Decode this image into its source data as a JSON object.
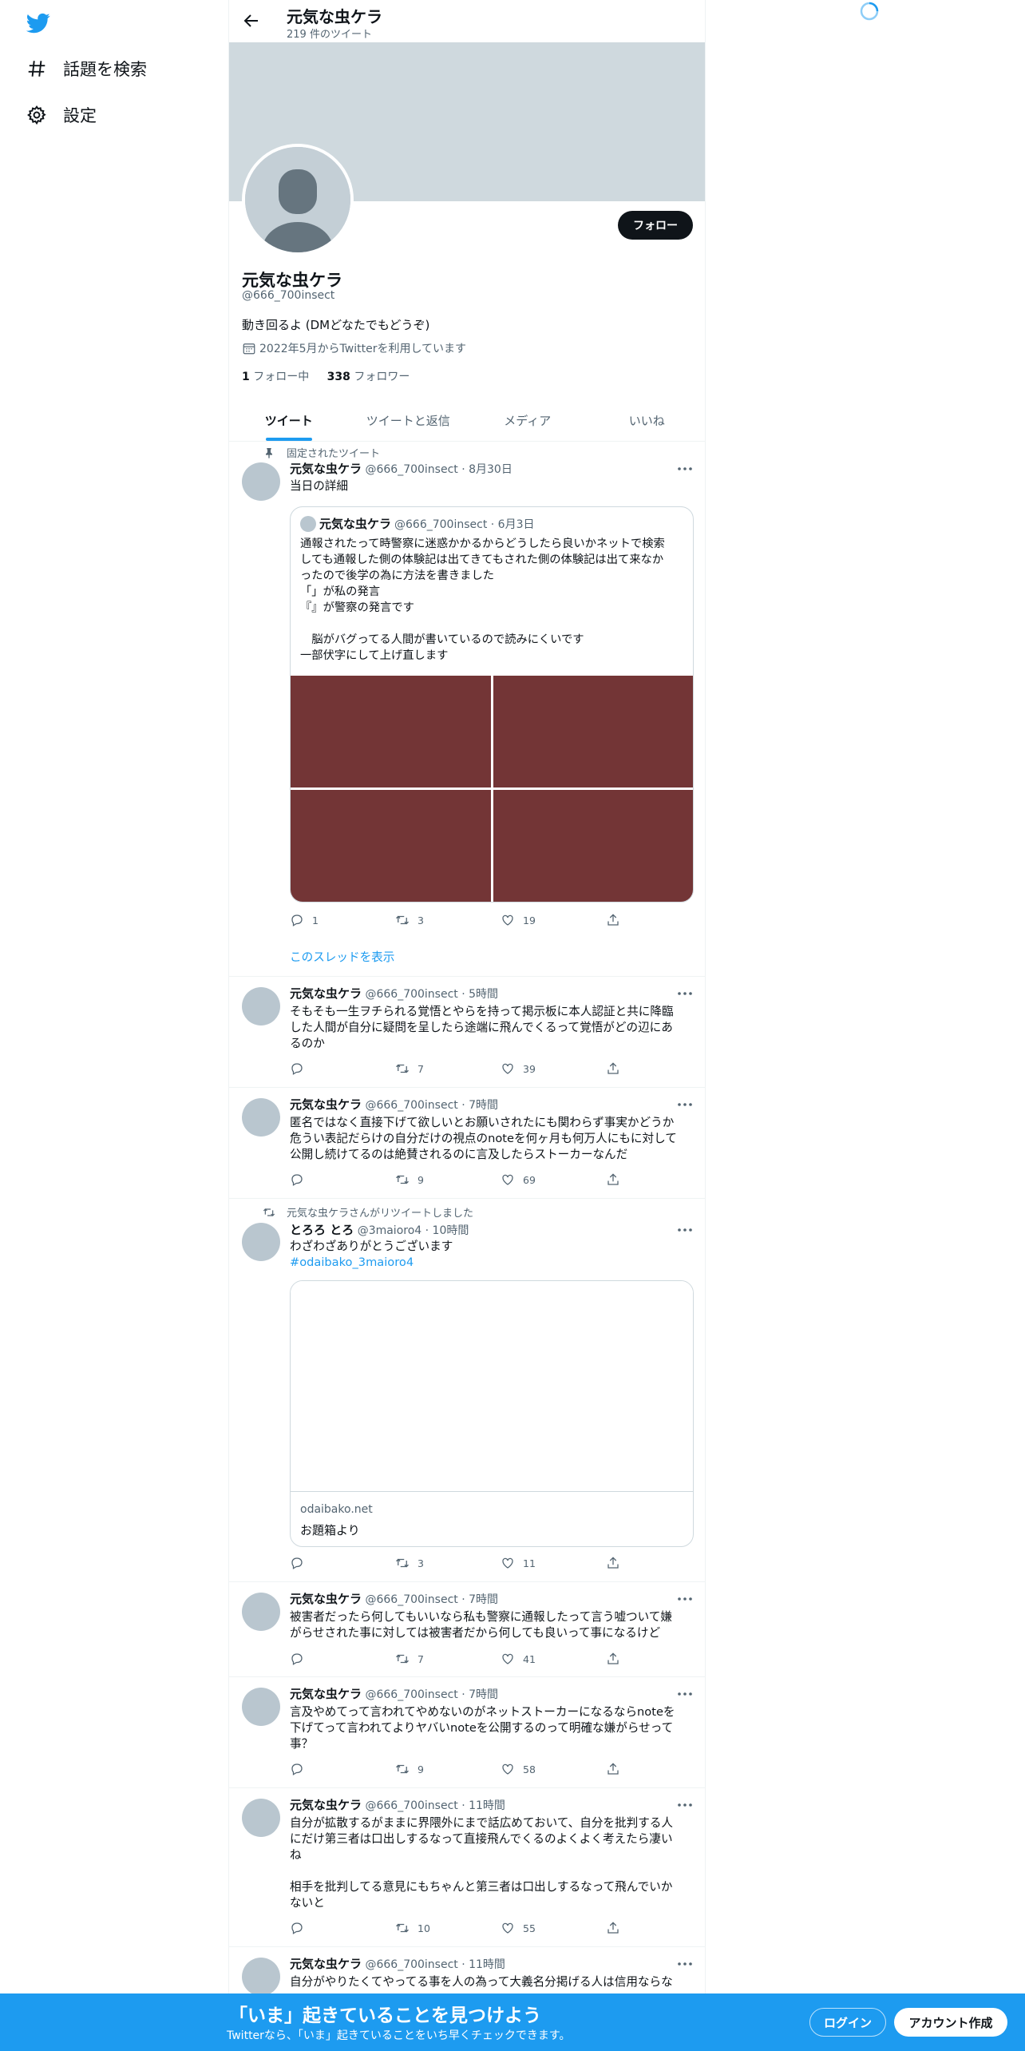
{
  "nav": {
    "explore_label": "話題を検索",
    "settings_label": "設定"
  },
  "header": {
    "title": "元気な虫ケラ",
    "subtitle": "219 件のツイート"
  },
  "profile": {
    "follow_button": "フォロー",
    "name": "元気な虫ケラ",
    "handle": "@666_700insect",
    "bio": "動き回るよ (DMどなたでもどうぞ)",
    "joined": "2022年5月からTwitterを利用しています",
    "following_count": "1",
    "following_label": "フォロー中",
    "followers_count": "338",
    "followers_label": "フォロワー"
  },
  "tabs": [
    "ツイート",
    "ツイートと返信",
    "メディア",
    "いいね"
  ],
  "tweets": [
    {
      "social": "固定されたツイート",
      "name": "元気な虫ケラ",
      "meta": "@666_700insect · 8月30日",
      "text": "当日の詳細",
      "quote": {
        "name": "元気な虫ケラ",
        "meta": "@666_700insect · 6月3日",
        "text": "通報されたって時警察に迷惑かかるからどうしたら良いかネットで検索\nしても通報した側の体験記は出てきてもされた側の体験記は出て来なか\nったので後学の為に方法を書きました\n「」が私の発言\n『』が警察の発言です\n\n　脳がバグってる人間が書いているので読みにくいです\n一部伏字にして上げ直します"
      },
      "reply": "1",
      "retweet": "3",
      "like": "19",
      "thread_link": "このスレッドを表示"
    },
    {
      "name": "元気な虫ケラ",
      "meta": "@666_700insect · 5時間",
      "text": "そもそも一生ヲチられる覚悟とやらを持って掲示板に本人認証と共に降臨\nした人間が自分に疑問を呈したら途端に飛んでくるって覚悟がどの辺にあ\nるのか",
      "reply": "",
      "retweet": "7",
      "like": "39"
    },
    {
      "name": "元気な虫ケラ",
      "meta": "@666_700insect · 7時間",
      "text": "匿名ではなく直接下げて欲しいとお願いされたにも関わらず事実かどうか\n危うい表記だらけの自分だけの視点のnoteを何ヶ月も何万人にもに対して\n公開し続けてるのは絶賛されるのに言及したらストーカーなんだ",
      "reply": "",
      "retweet": "9",
      "like": "69"
    },
    {
      "social": "元気な虫ケラさんがリツイートしました",
      "name": "とろろ とろ",
      "meta": "@3maioro4 · 10時間",
      "text": "わざわざありがとうございます",
      "hashtag": "#odaibako_3maioro4",
      "card_domain": "odaibako.net",
      "card_title": "お題箱より",
      "reply": "",
      "retweet": "3",
      "like": "11"
    },
    {
      "name": "元気な虫ケラ",
      "meta": "@666_700insect · 7時間",
      "text": "被害者だったら何してもいいなら私も警察に通報したって言う嘘ついて嫌\nがらせされた事に対しては被害者だから何しても良いって事になるけど",
      "reply": "",
      "retweet": "7",
      "like": "41"
    },
    {
      "name": "元気な虫ケラ",
      "meta": "@666_700insect · 7時間",
      "text": "言及やめてって言われてやめないのがネットストーカーになるならnoteを\n下げてって言われてよりヤバいnoteを公開するのって明確な嫌がらせって\n事？",
      "reply": "",
      "retweet": "9",
      "like": "58"
    },
    {
      "name": "元気な虫ケラ",
      "meta": "@666_700insect · 11時間",
      "text": "自分が拡散するがままに界隈外にまで話広めておいて、自分を批判する人\nにだけ第三者は口出しするなって直接飛んでくるのよくよく考えたら凄い\nね\n\n相手を批判してる意見にもちゃんと第三者は口出しするなって飛んでいか\nないと",
      "reply": "",
      "retweet": "10",
      "like": "55"
    },
    {
      "name": "元気な虫ケラ",
      "meta": "@666_700insect · 11時間",
      "text": "自分がやりたくてやってる事を人の為って大義名分掲げる人は信用ならな"
    }
  ],
  "bottom_bar": {
    "title": "「いま」起きていることを見つけよう",
    "subtitle": "Twitterなら、「いま」起きていることをいち早くチェックできます。",
    "login": "ログイン",
    "signup": "アカウント作成"
  },
  "colors": {
    "accent": "#1d9bf0",
    "text": "#0f1419",
    "muted": "#536471",
    "banner": "#cfd9de",
    "media": "#733536"
  }
}
